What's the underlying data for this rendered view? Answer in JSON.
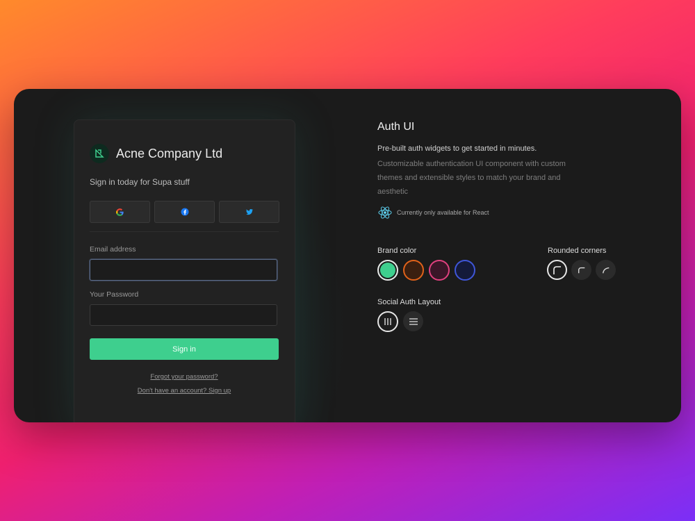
{
  "login_card": {
    "company_name": "Acne Company Ltd",
    "subtitle": "Sign in today for Supa stuff",
    "social_providers": [
      {
        "name": "google",
        "icon": "google-icon"
      },
      {
        "name": "facebook",
        "icon": "facebook-icon"
      },
      {
        "name": "twitter",
        "icon": "twitter-icon"
      }
    ],
    "email_label": "Email address",
    "email_value": "",
    "password_label": "Your Password",
    "password_value": "",
    "sign_in_label": "Sign in",
    "forgot_password_link": "Forgot your password?",
    "signup_link": "Don't have an account? Sign up"
  },
  "info": {
    "title": "Auth UI",
    "tagline": "Pre-built auth widgets to get started in minutes.",
    "description": "Customizable authentication UI component with custom themes and extensible styles to match your brand and aesthetic",
    "react_note": "Currently only available for React"
  },
  "options": {
    "brand_color_label": "Brand color",
    "brand_colors": [
      {
        "name": "green",
        "fill": "#3ecf8e",
        "ring": "#e8e8e8",
        "selected": true
      },
      {
        "name": "orange",
        "fill": "#3a1f10",
        "ring": "#e0621a",
        "selected": false
      },
      {
        "name": "pink",
        "fill": "#3a1628",
        "ring": "#e0407f",
        "selected": false
      },
      {
        "name": "blue",
        "fill": "#141a3a",
        "ring": "#3f56d8",
        "selected": false
      }
    ],
    "rounded_corners_label": "Rounded corners",
    "rounded_corners_options": [
      {
        "name": "large",
        "selected": true
      },
      {
        "name": "medium",
        "selected": false
      },
      {
        "name": "small",
        "selected": false
      }
    ],
    "social_layout_label": "Social Auth Layout",
    "social_layout_options": [
      {
        "name": "horizontal",
        "selected": true
      },
      {
        "name": "vertical",
        "selected": false
      }
    ]
  },
  "colors": {
    "accent": "#3ecf8e",
    "panel_bg": "#1b1b1b",
    "card_bg": "#222222"
  }
}
